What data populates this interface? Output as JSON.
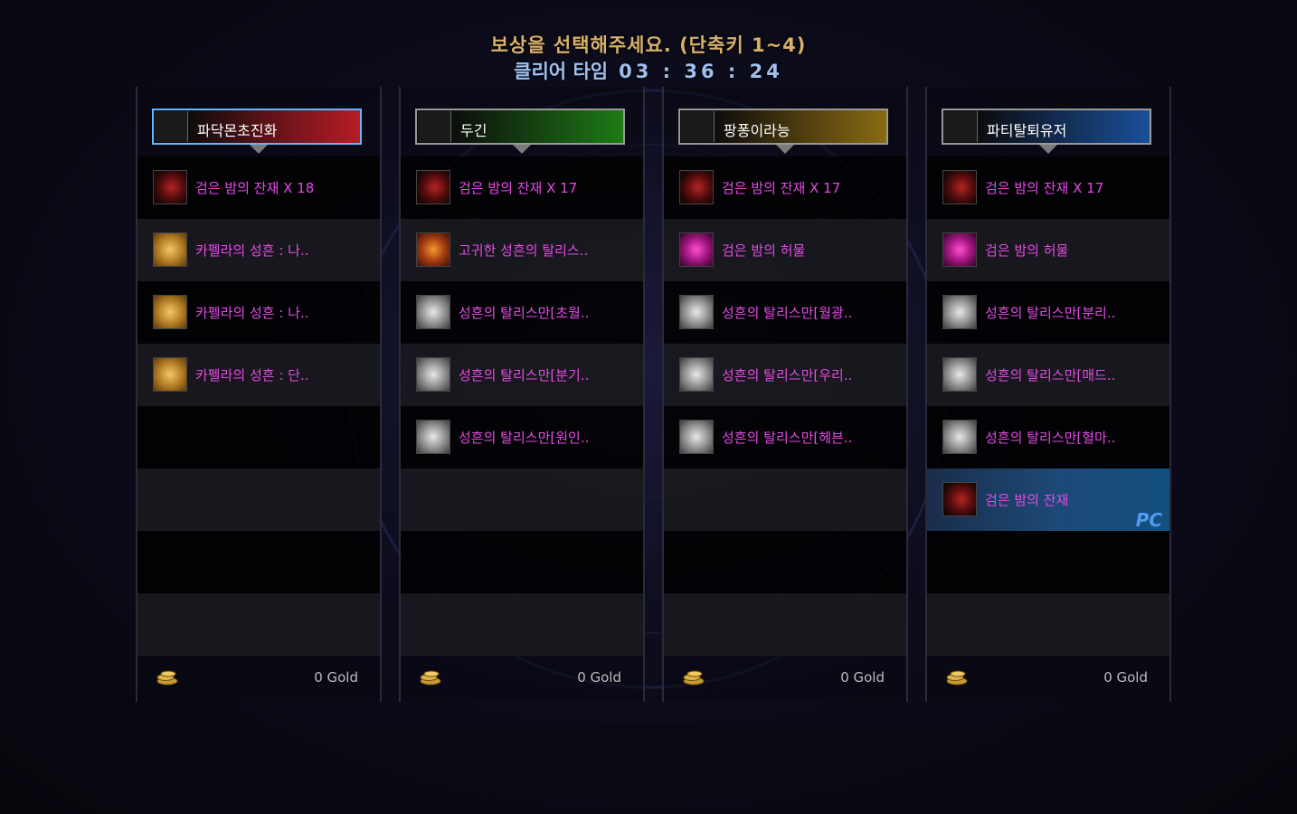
{
  "title": "보상을 선택해주세요. (단축키 1~4)",
  "clear_time": {
    "label": "클리어 타임",
    "value": "03 : 36 : 24"
  },
  "players": [
    {
      "name": "파닥몬초진화",
      "header_color": "#b81c24",
      "items": [
        {
          "name": "검은 밤의 잔재 X 18",
          "icon": "black-night-remnant-icon"
        },
        {
          "name": "카펠라의 성흔 : 나..",
          "icon": "capella-stigma-icon"
        },
        {
          "name": "카펠라의 성흔 : 나..",
          "icon": "capella-stigma-icon"
        },
        {
          "name": "카펠라의 성흔 : 단..",
          "icon": "capella-stigma-icon"
        }
      ],
      "gold": "0 Gold"
    },
    {
      "name": "두긴",
      "header_color": "#1e7a16",
      "items": [
        {
          "name": "검은 밤의 잔재 X 17",
          "icon": "black-night-remnant-icon"
        },
        {
          "name": "고귀한 성흔의 탈리스..",
          "icon": "noble-stigma-talisman-icon"
        },
        {
          "name": "성흔의 탈리스만[초월..",
          "icon": "stigma-talisman-icon"
        },
        {
          "name": "성흔의 탈리스만[분기..",
          "icon": "stigma-talisman-icon"
        },
        {
          "name": "성흔의 탈리스만[원인..",
          "icon": "stigma-talisman-icon"
        }
      ],
      "gold": "0 Gold"
    },
    {
      "name": "팡퐁이라능",
      "header_color": "#8a6a12",
      "items": [
        {
          "name": "검은 밤의 잔재 X 17",
          "icon": "black-night-remnant-icon"
        },
        {
          "name": "검은 밤의 허물",
          "icon": "black-night-husk-icon"
        },
        {
          "name": "성흔의 탈리스만[월광..",
          "icon": "stigma-talisman-icon"
        },
        {
          "name": "성흔의 탈리스만[우리..",
          "icon": "stigma-talisman-icon"
        },
        {
          "name": "성흔의 탈리스만[헤븐..",
          "icon": "stigma-talisman-icon"
        }
      ],
      "gold": "0 Gold"
    },
    {
      "name": "파티탈퇴유저",
      "header_color": "#1a4f9a",
      "items": [
        {
          "name": "검은 밤의 잔재 X 17",
          "icon": "black-night-remnant-icon"
        },
        {
          "name": "검은 밤의 허물",
          "icon": "black-night-husk-icon"
        },
        {
          "name": "성흔의 탈리스만[분리..",
          "icon": "stigma-talisman-icon"
        },
        {
          "name": "성흔의 탈리스만[매드..",
          "icon": "stigma-talisman-icon"
        },
        {
          "name": "성흔의 탈리스만[혈마..",
          "icon": "stigma-talisman-icon"
        },
        {
          "name": "검은 밤의 잔재",
          "icon": "black-night-remnant-icon",
          "selected": true,
          "tag": "PC"
        }
      ],
      "gold": "0 Gold"
    }
  ]
}
